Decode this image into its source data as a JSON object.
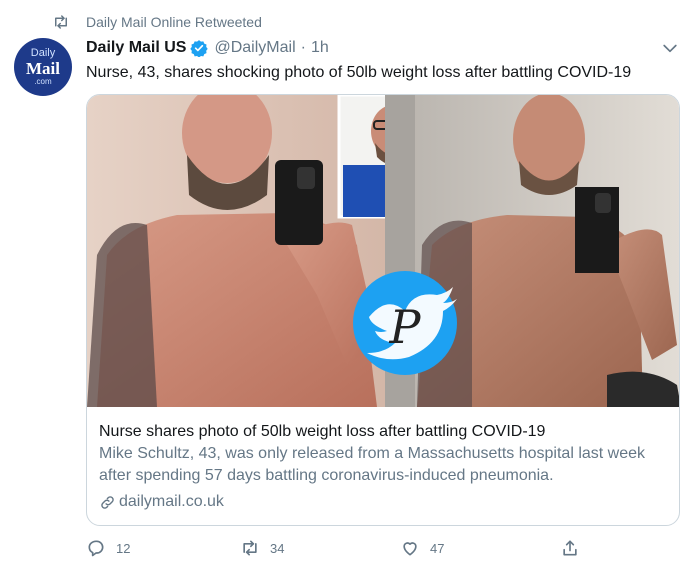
{
  "retweet": {
    "icon": "retweet-icon",
    "text": "Daily Mail Online Retweeted"
  },
  "author": {
    "avatar": {
      "line1": "Daily",
      "line2": "Mail",
      "line3": ".com"
    },
    "name": "Daily Mail US",
    "verified_icon": "verified-badge-icon",
    "handle": "@DailyMail",
    "separator": "·",
    "time": "1h"
  },
  "tweet": {
    "text": "Nurse, 43, shares shocking photo of 50lb weight loss after battling COVID-19"
  },
  "card": {
    "image_alt": "Before and after mirror selfies with inset photo of nurse in scrubs",
    "watermark_letter": "P",
    "title": "Nurse shares photo of 50lb weight loss after battling COVID-19",
    "description": "Mike Schultz, 43, was only released from a Massachusetts hospital last week after spending 57 days battling coronavirus-induced pneumonia.",
    "link_icon": "link-icon",
    "domain": "dailymail.co.uk"
  },
  "actions": {
    "reply": {
      "icon": "reply-icon",
      "count": "12"
    },
    "retweet": {
      "icon": "retweet-icon",
      "count": "34"
    },
    "like": {
      "icon": "heart-icon",
      "count": "47"
    },
    "share": {
      "icon": "share-icon"
    }
  },
  "colors": {
    "twitter_blue": "#1da1f2",
    "secondary_text": "#657786",
    "primary_text": "#14171a",
    "border": "#ccd6dd",
    "avatar_bg": "#1e3a8a"
  }
}
